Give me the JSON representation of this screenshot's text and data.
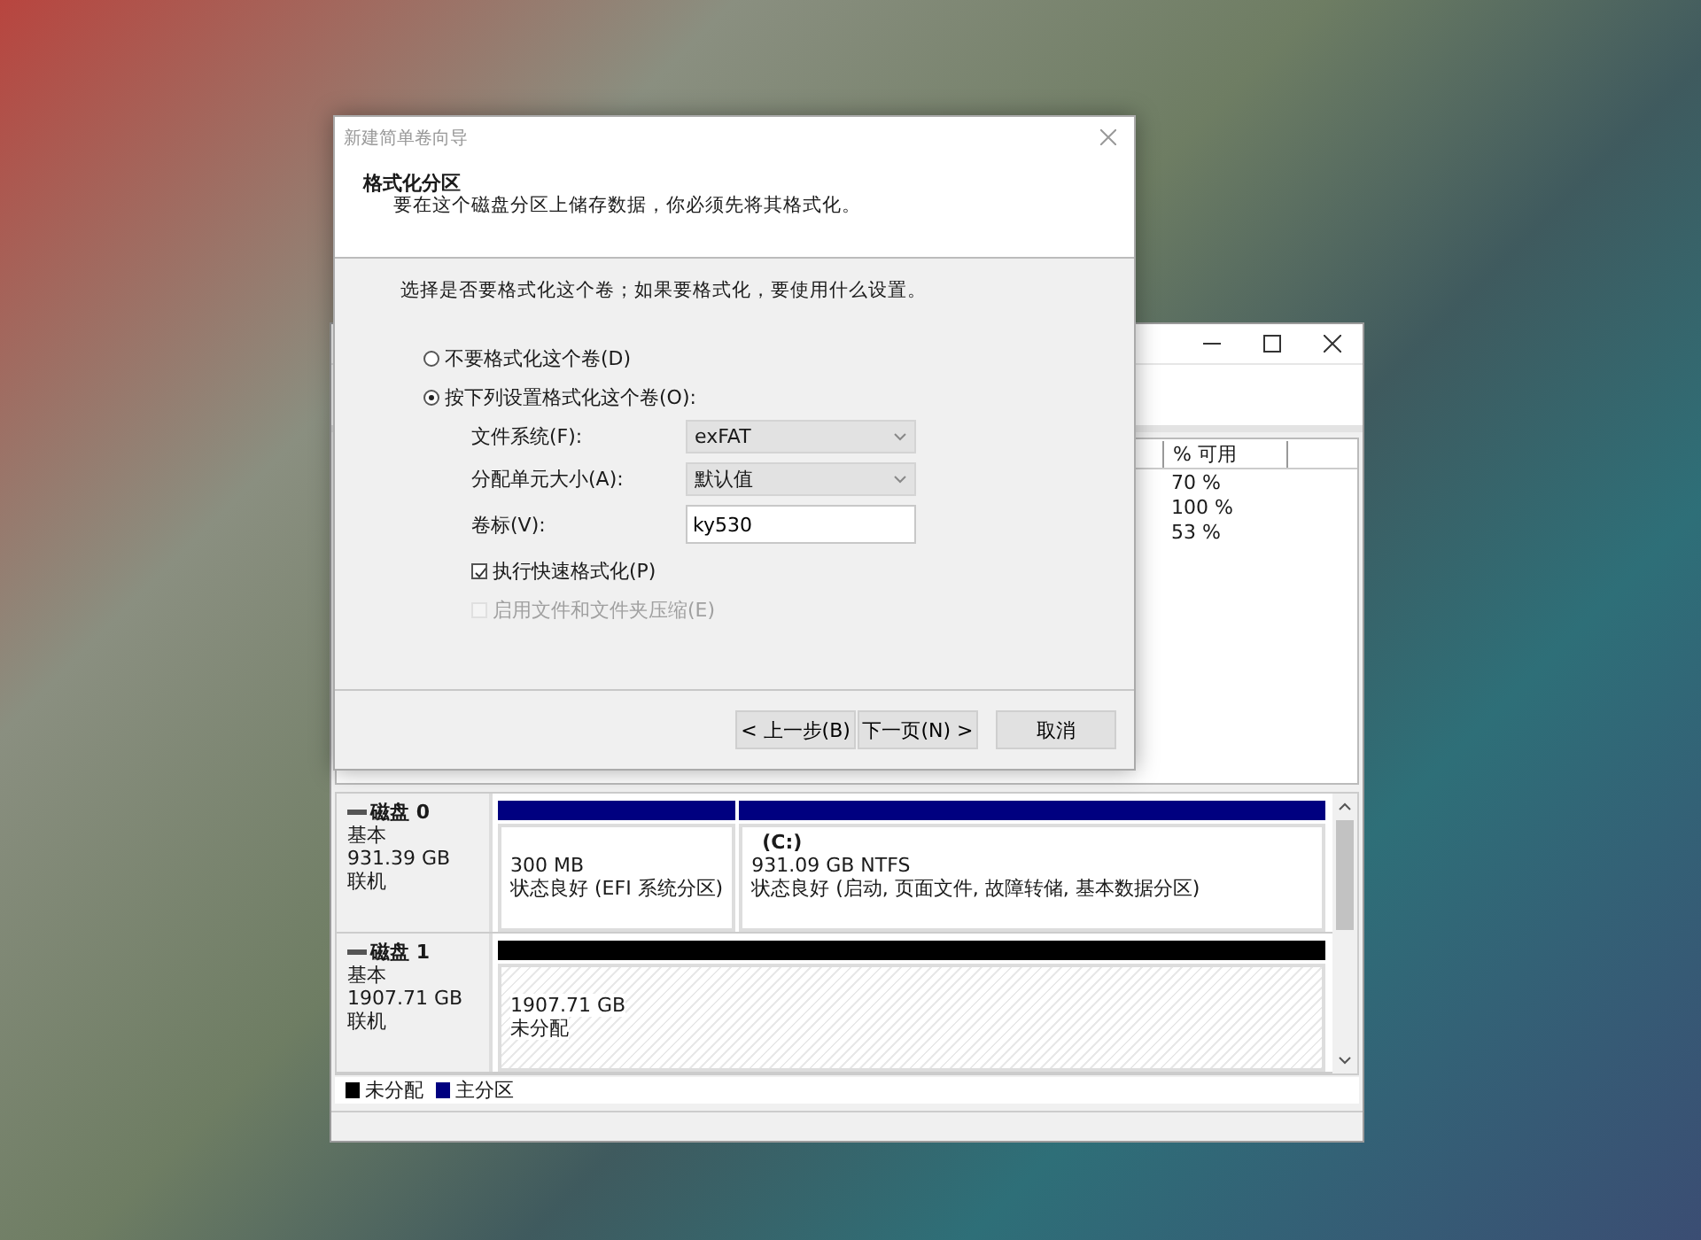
{
  "wizard": {
    "title": "新建简单卷向导",
    "heading": "格式化分区",
    "subheading": "要在这个磁盘分区上储存数据，你必须先将其格式化。",
    "prompt": "选择是否要格式化这个卷；如果要格式化，要使用什么设置。",
    "options": [
      {
        "label": "不要格式化这个卷(D)",
        "selected": false
      },
      {
        "label": "按下列设置格式化这个卷(O):",
        "selected": true
      }
    ],
    "fields": [
      {
        "kind": "dropdown",
        "label": "文件系统(F):",
        "value": "exFAT"
      },
      {
        "kind": "dropdown",
        "label": "分配单元大小(A):",
        "value": "默认值"
      },
      {
        "kind": "text",
        "label": "卷标(V):",
        "value": "ky530"
      }
    ],
    "checkboxes": [
      {
        "label": "执行快速格式化(P)",
        "checked": true,
        "disabled": false
      },
      {
        "label": "启用文件和文件夹压缩(E)",
        "checked": false,
        "disabled": true
      }
    ],
    "buttons": [
      "< 上一步(B)",
      "下一页(N) >",
      "取消"
    ]
  },
  "disk_management": {
    "volume_table": {
      "columns": [
        "% 可用"
      ],
      "rows": [
        [
          "70 %"
        ],
        [
          "100 %"
        ],
        [
          "53 %"
        ]
      ]
    },
    "disks": [
      {
        "name": "磁盘 0",
        "type": "基本",
        "size": "931.39 GB",
        "status": "联机",
        "partitions": [
          {
            "kind": "primary",
            "size": "300 MB",
            "status": "状态良好 (EFI 系统分区)"
          },
          {
            "kind": "primary",
            "label": "(C:)",
            "size": "931.09 GB NTFS",
            "status": "状态良好 (启动, 页面文件, 故障转储, 基本数据分区)"
          }
        ]
      },
      {
        "name": "磁盘 1",
        "type": "基本",
        "size": "1907.71 GB",
        "status": "联机",
        "partitions": [
          {
            "kind": "unallocated",
            "size": "1907.71 GB",
            "status": "未分配"
          }
        ]
      }
    ],
    "legend": [
      {
        "label": "未分配",
        "color": "#000000"
      },
      {
        "label": "主分区",
        "color": "#000080"
      }
    ]
  }
}
